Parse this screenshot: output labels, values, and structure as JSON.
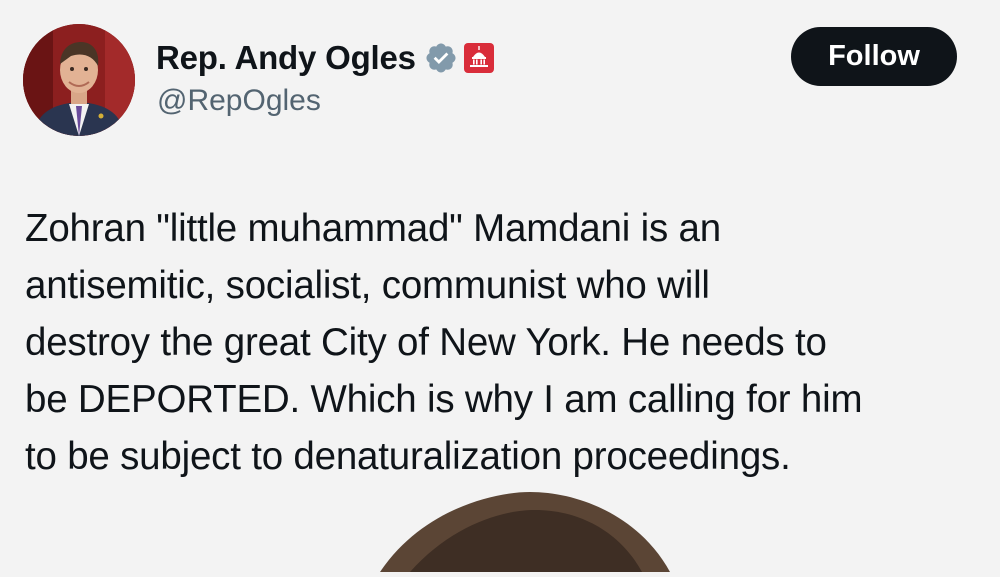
{
  "author": {
    "display_name": "Rep. Andy Ogles",
    "handle": "@RepOgles",
    "verified_icon": "verified-badge-icon",
    "affiliation_icon": "capitol-building-icon",
    "verified_color": "#829aab",
    "affiliation_color": "#d92d3a"
  },
  "actions": {
    "follow_label": "Follow"
  },
  "post": {
    "lines": [
      "Zohran \"little muhammad\" Mamdani is an",
      "antisemitic, socialist, communist who will",
      "destroy the great City of New York. He needs to",
      "be DEPORTED. Which is why I am calling for him",
      "to be subject to denaturalization proceedings."
    ]
  },
  "colors": {
    "background": "#f3f3f3",
    "text": "#0f1419",
    "secondary_text": "#536471",
    "button_bg": "#0f1419",
    "button_text": "#ffffff"
  }
}
